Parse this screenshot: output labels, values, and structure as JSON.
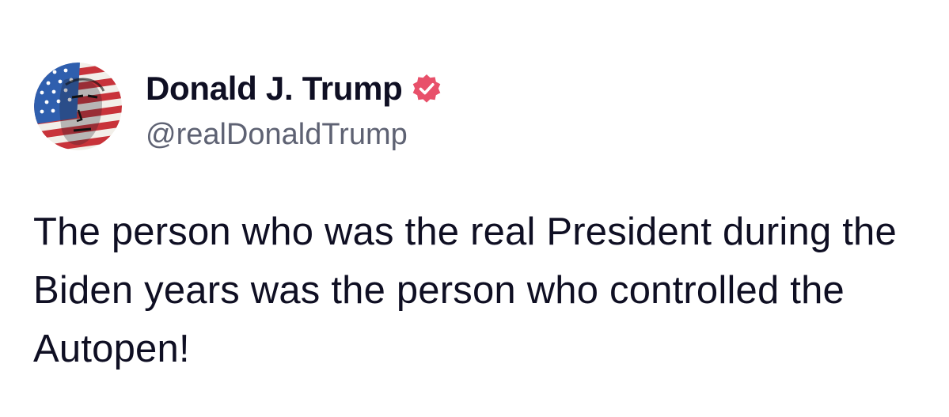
{
  "post": {
    "author": {
      "display_name": "Donald J. Trump",
      "handle": "@realDonaldTrump",
      "avatar_icon": "flag-portrait-avatar",
      "verified_icon": "verified-badge-icon",
      "verified_color": "#e8506a"
    },
    "body": "The person who was the real President during the Biden years was the person who controlled the Autopen!"
  }
}
